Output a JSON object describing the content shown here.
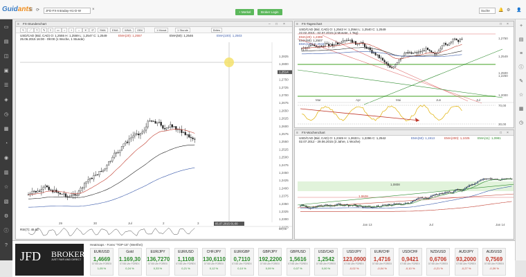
{
  "app": {
    "logo_a": "Guid",
    "logo_b": "ants",
    "tab": "JFD-FX-Intraday-H1-D-W",
    "tab_close": "×",
    "btn_watch": "+ Merkel",
    "btn_login": "Broker Login",
    "search": "Suche"
  },
  "left_icons": [
    "monitor-icon",
    "chart-icon",
    "layers-icon",
    "folder-icon",
    "list-icon",
    "tag-icon",
    "clock-icon",
    "calendar-icon",
    "bell-icon",
    "user-icon",
    "grid-icon",
    "star-icon",
    "news-icon",
    "settings-icon",
    "info-icon",
    "help-icon"
  ],
  "p1": {
    "title": "FX-Stundenchart",
    "tools": [
      "SMA",
      "EMA",
      "WMA",
      "OBV",
      "1 Monat",
      "1 Stunde",
      "Brites"
    ],
    "ohlc1": "USD/CAD (Bid, CAD)  O: 1,2555  H: 1,2559  L: 1,2547  C: 1,2549",
    "ohlc2": "25.06.2015 16:00 - 09:00 (1 Woche, 1 Stunde)",
    "leg1": "EMA(20): 1,2557",
    "leg2": "EMA(50): 1,2546",
    "leg3": "EMA(100): 1,2503",
    "yaxis": [
      "1,2825",
      "1,2800",
      "1,2514",
      "1,2750",
      "1,2725",
      "1,2700",
      "1,2675",
      "1,2650",
      "1,2625",
      "1,2600",
      "1,2575",
      "1,2550",
      "1,2525",
      "1,2500",
      "1,2475",
      "1,2450",
      "1,2425",
      "1,2400",
      "1,2375",
      "1,2350",
      "1,2325",
      "1,2300",
      "1,2275"
    ],
    "xaxis": [
      "29",
      "30",
      "Jul",
      "2",
      "3"
    ],
    "crosshair": "05.07.2015 01:00",
    "rsi": "RSI(7): 45,62",
    "rsi_v": "50,00"
  },
  "p2": {
    "title": "FX-Tageschart",
    "ohlc1": "USD/CAD (Bid, CAD)  O: 1,2542  H: 1,2564  L: 1,2540  C: 1,2549",
    "ohlc2": "22.02.2015 - 02.07.2015 (4 Monate, 1 Tag)",
    "leg1": "EMA(20): 1,2399",
    "leg2": "EMA(50): 1,2507",
    "leg3": "EMA(100): 1,2544",
    "yaxis": [
      "1,2750",
      "1,2549",
      "1,2500",
      "1,2250",
      "1,2000"
    ],
    "xaxis": [
      "Mar",
      "Apr",
      "Mai",
      "Jun",
      "Jul"
    ],
    "osc": [
      "70,00",
      "30,00"
    ]
  },
  "p3": {
    "title": "FX-Wochenchart",
    "ohlc1": "USD/CAD (Bid, CAD)  O: 1,2345  H: 1,2633  L: 1,2296  C: 1,2542",
    "ohlc2": "02.07.2012 - 29.06.2015 (3 Jahre, 1 Woche)",
    "leg1": "EMA(50): 1,1913",
    "leg2": "EMA(200): 1,1025",
    "leg3": "EMA(11): 1,0981",
    "level": "1,0808",
    "level2": "1,0628",
    "xaxis": [
      "Jan 13",
      "Jul",
      "Jan 14"
    ]
  },
  "bottom": {
    "logo": "JFD",
    "logo2": "BROKERS",
    "tagline": "JUST FAIR AND DIRECT",
    "heatmap_title": "Heatmaps - Forex \"TOP-15\" (Wertfrei)",
    "tiles": [
      {
        "n": "EUR/USD",
        "v": "1,4669",
        "c": "1,05 %",
        "dir": "up"
      },
      {
        "n": "Gold",
        "v": "1.169,30",
        "c": "0,24 %",
        "dir": "up"
      },
      {
        "n": "EUR/JPY",
        "v": "136,7270",
        "c": "0,33 %",
        "dir": "up"
      },
      {
        "n": "EUR/USD",
        "v": "1,1108",
        "c": "0,21 %",
        "dir": "up"
      },
      {
        "n": "CHF/JPY",
        "v": "130,6110",
        "c": "0,12 %",
        "dir": "up"
      },
      {
        "n": "EUR/GBP",
        "v": "0,7110",
        "c": "0,10 %",
        "dir": "up"
      },
      {
        "n": "GBP/JPY",
        "v": "192,2200",
        "c": "0,09 %",
        "dir": "up"
      },
      {
        "n": "GBP/USD",
        "v": "1,5616",
        "c": "0,07 %",
        "dir": "up"
      },
      {
        "n": "USD/CAD",
        "v": "1,2542",
        "c": "0,00 %",
        "dir": "up"
      },
      {
        "n": "USD/JPY",
        "v": "123,0900",
        "c": "-0,02 %",
        "dir": "dn"
      },
      {
        "n": "EUR/CHF",
        "v": "1,4716",
        "c": "-0,04 %",
        "dir": "dn"
      },
      {
        "n": "USD/CHF",
        "v": "0,9421",
        "c": "-0,10 %",
        "dir": "dn"
      },
      {
        "n": "NZD/USD",
        "v": "0,6706",
        "c": "-0,21 %",
        "dir": "dn"
      },
      {
        "n": "AUD/JPY",
        "v": "93,2000",
        "c": "-0,27 %",
        "dir": "dn"
      },
      {
        "n": "AUD/USD",
        "v": "0,7569",
        "c": "-0,39 %",
        "dir": "dn"
      }
    ],
    "tile_sub": "07:55 Uhr FOREX"
  }
}
